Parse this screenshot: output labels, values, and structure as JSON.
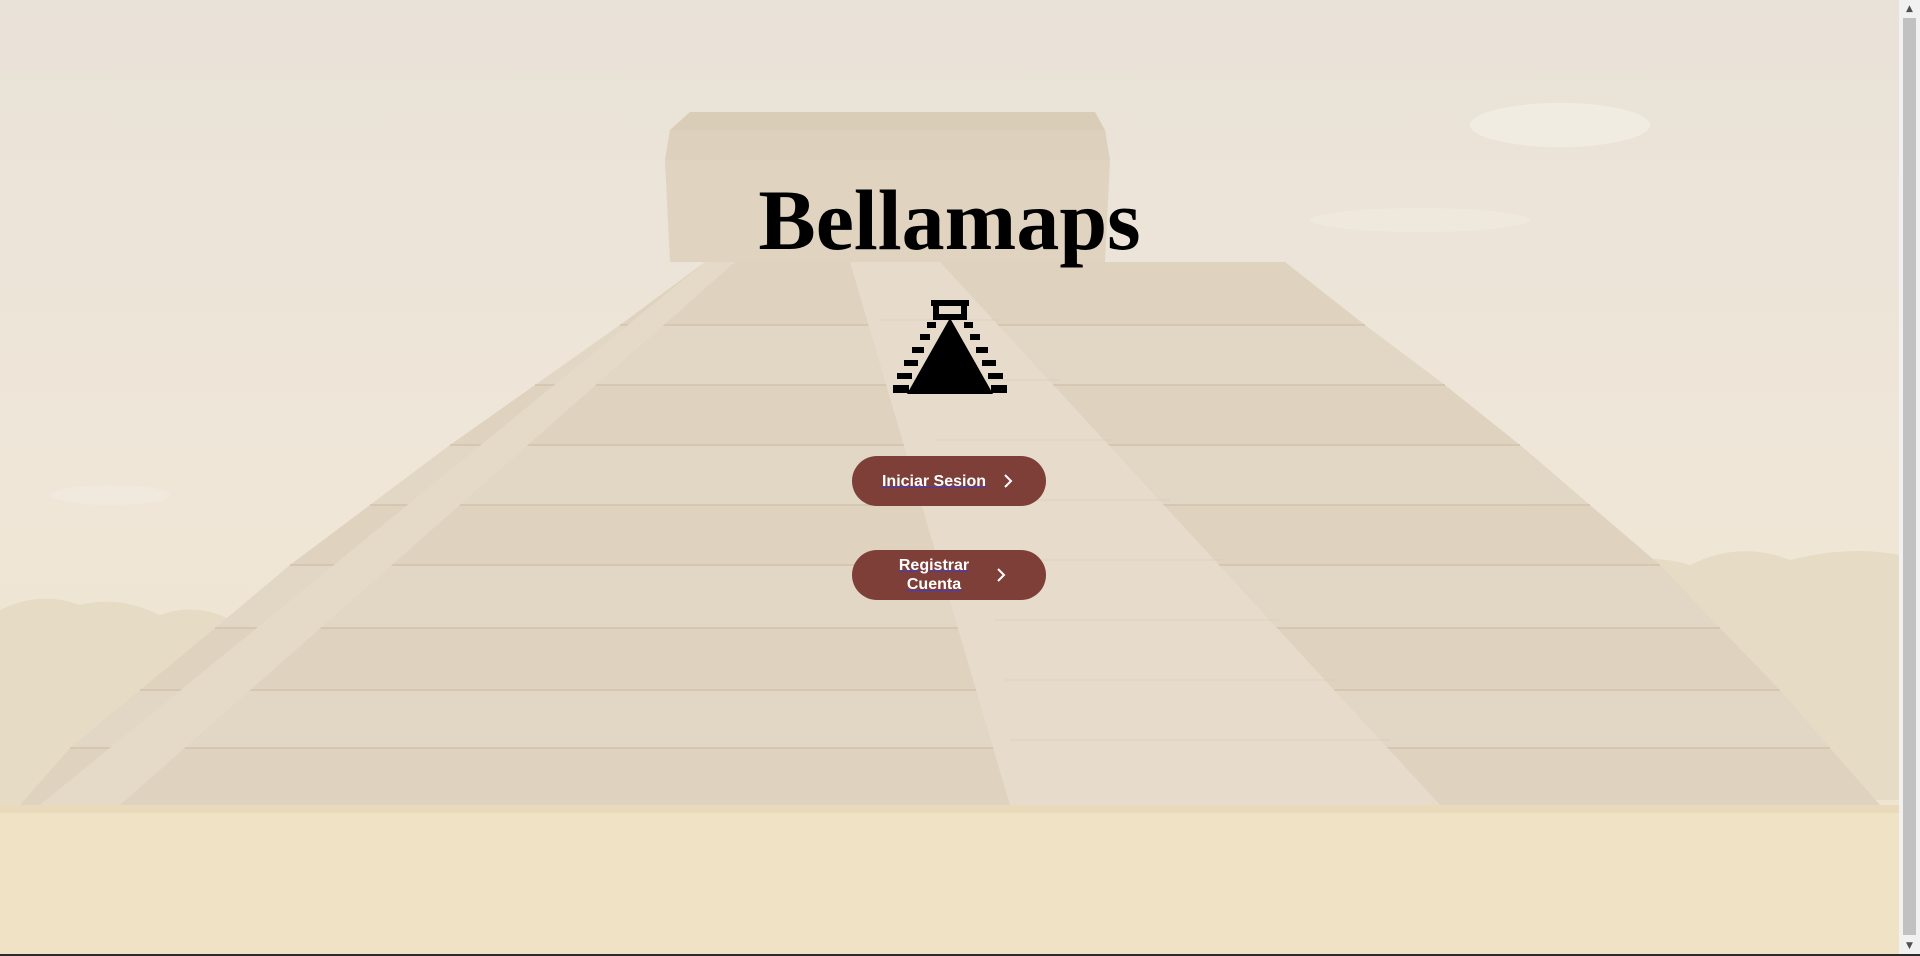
{
  "page": {
    "title": "Bellamaps"
  },
  "logo": {
    "icon": "pyramid-icon"
  },
  "buttons": {
    "login_label": "Iniciar Sesion",
    "register_label": "Registrar Cuenta",
    "chevron_icon": "chevron-right-icon"
  },
  "background": {
    "description_icon": "pyramid-background-image"
  },
  "colors": {
    "button_bg": "#7e3f38",
    "button_text": "#ffffff",
    "title": "#000000"
  }
}
